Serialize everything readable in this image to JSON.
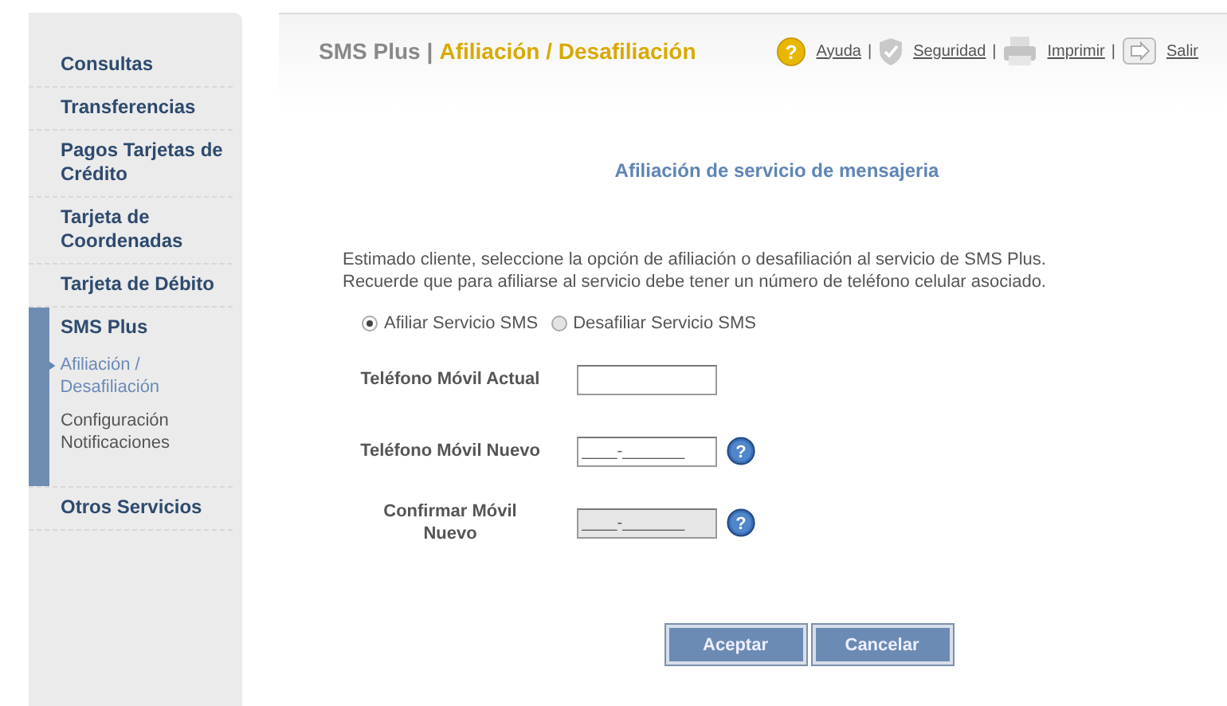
{
  "sidebar": {
    "items": [
      {
        "label": "Consultas"
      },
      {
        "label": "Transferencias"
      },
      {
        "label": "Pagos Tarjetas de Crédito"
      },
      {
        "label": "Tarjeta de Coordenadas"
      },
      {
        "label": "Tarjeta de Débito"
      },
      {
        "label": "SMS Plus",
        "children": [
          {
            "label": "Afiliación / Desafiliación",
            "selected": true
          },
          {
            "label": "Configuración Notificaciones",
            "selected": false
          }
        ]
      },
      {
        "label": "Otros Servicios"
      }
    ]
  },
  "header": {
    "section": "SMS Plus",
    "separator": "|",
    "page": "Afiliación / Desafiliación",
    "links": [
      {
        "kind": "help",
        "icon_text": "?",
        "label": "Ayuda",
        "separator": "|"
      },
      {
        "kind": "security",
        "label": "Seguridad",
        "separator": "|"
      },
      {
        "kind": "print",
        "label": "Imprimir",
        "separator": "|"
      },
      {
        "kind": "exit",
        "label": "Salir"
      }
    ]
  },
  "form": {
    "title": "Afiliación de servicio de mensajeria",
    "intro": "Estimado cliente, seleccione la opción de afiliación o desafiliación al servicio de SMS Plus. Recuerde que para afiliarse al servicio debe tener un número de teléfono celular asociado.",
    "options": [
      {
        "label": "Afiliar Servicio SMS",
        "selected": true
      },
      {
        "label": "Desafiliar Servicio SMS",
        "selected": false
      }
    ],
    "fields": [
      {
        "label": "Teléfono Móvil Actual",
        "disabled": false
      },
      {
        "label": "Teléfono Móvil Nuevo",
        "value": "____-_______",
        "disabled": false,
        "help_icon": "?"
      },
      {
        "label": "Confirmar Móvil Nuevo",
        "value": "____-_______",
        "disabled": true,
        "help_icon": "?"
      }
    ],
    "buttons": [
      "Aceptar",
      "Cancelar"
    ]
  }
}
